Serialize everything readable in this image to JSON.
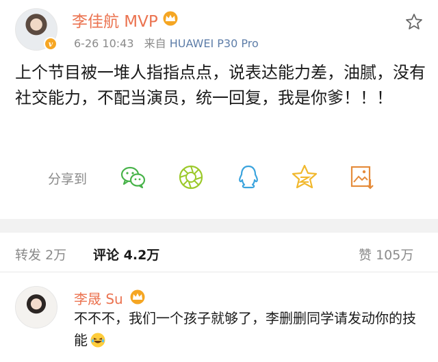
{
  "post": {
    "username": "李佳航 MVP",
    "time": "6-26 10:43",
    "source_prefix": "来自",
    "device": "HUAWEI P30 Pro",
    "verified_badge": "v",
    "content": "上个节目被一堆人指指点点，说表达能力差，油腻，没有社交能力，不配当演员，统一回复，我是你爹！！！"
  },
  "share": {
    "label": "分享到",
    "icons": [
      "wechat-icon",
      "moments-icon",
      "qq-icon",
      "qzone-icon",
      "save-image-icon"
    ]
  },
  "stats": {
    "repost_label": "转发",
    "repost_count": "2万",
    "comment_label": "评论",
    "comment_count": "4.2万",
    "like_label": "赞",
    "like_count": "105万"
  },
  "comment": {
    "username": "李晟 Su",
    "text": "不不不，我们一个孩子就够了，李删删同学请发动你的技能"
  },
  "colors": {
    "username": "#eb7350",
    "device_link": "#5d7da8",
    "share_green": "#48b34a",
    "share_lime": "#9bc92a",
    "share_blue": "#3aa3dd",
    "share_yellow": "#f1b82d",
    "share_orange": "#e58b3a"
  }
}
